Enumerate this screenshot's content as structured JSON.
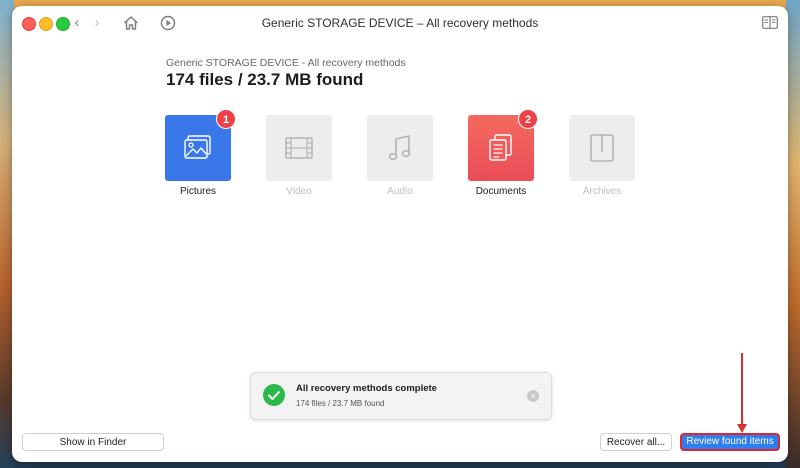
{
  "window": {
    "title": "Generic STORAGE DEVICE – All recovery methods",
    "nav_back": "‹",
    "nav_forward": "›"
  },
  "header": {
    "subtitle": "Generic STORAGE DEVICE - All recovery methods",
    "summary": "174 files / 23.7 MB found"
  },
  "categories": [
    {
      "label": "Pictures",
      "icon": "picture-icon",
      "active": true,
      "badge": "1",
      "color": "#3a78ea"
    },
    {
      "label": "Video",
      "icon": "film-icon",
      "active": false,
      "badge": null,
      "color": "#ededed"
    },
    {
      "label": "Audio",
      "icon": "music-note-icon",
      "active": false,
      "badge": null,
      "color": "#ededed"
    },
    {
      "label": "Documents",
      "icon": "document-icon",
      "active": true,
      "badge": "2",
      "color": "#f0595a"
    },
    {
      "label": "Archives",
      "icon": "archive-icon",
      "active": false,
      "badge": null,
      "color": "#ededed"
    }
  ],
  "toast": {
    "title": "All recovery methods complete",
    "detail": "174 files / 23.7 MB found",
    "close": "×"
  },
  "buttons": {
    "show_in_finder": "Show in Finder",
    "recover_all": "Recover all...",
    "review_found_items": "Review found items"
  },
  "colors": {
    "accent": "#2f7ef0",
    "badge": "#ef4047",
    "success": "#2cb84b",
    "highlight": "#e0262a"
  }
}
